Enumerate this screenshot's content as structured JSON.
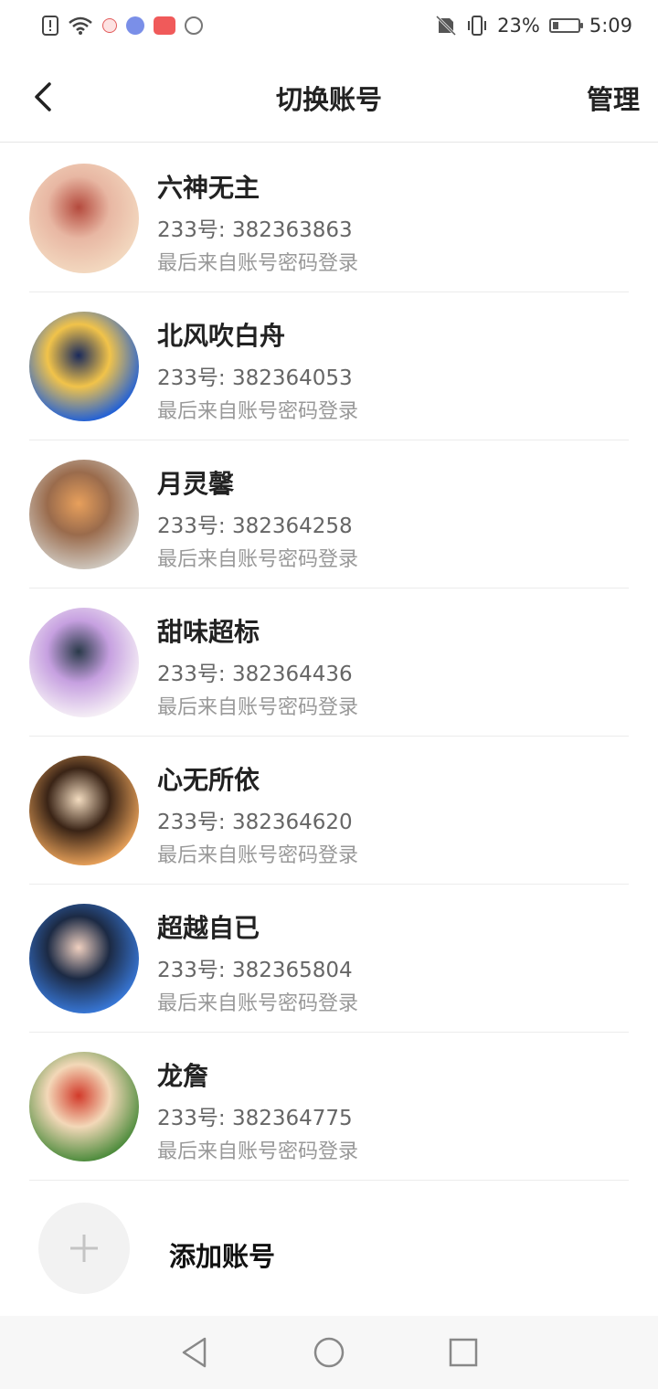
{
  "status_bar": {
    "battery_percent_text": "23%",
    "battery_level": 0.23,
    "time": "5:09",
    "icons": [
      "alert-icon",
      "wifi-icon",
      "app-icon",
      "music-app-icon",
      "store-app-icon",
      "game-app-icon",
      "no-sim-icon",
      "vibrate-icon",
      "battery-icon"
    ]
  },
  "header": {
    "title": "切换账号",
    "manage_label": "管理",
    "back_icon": "back-arrow-icon"
  },
  "accounts": [
    {
      "name": "六神无主",
      "id_text": "233号: 382363863",
      "login_text": "最后来自账号密码登录",
      "avatar_colors": [
        "#f3d9c0",
        "#e8b7a3",
        "#b44a3d"
      ]
    },
    {
      "name": "北风吹白舟",
      "id_text": "233号: 382364053",
      "login_text": "最后来自账号密码登录",
      "avatar_colors": [
        "#1f5fd8",
        "#f1c34a",
        "#1a2a5c"
      ]
    },
    {
      "name": "月灵馨",
      "id_text": "233号: 382364258",
      "login_text": "最后来自账号密码登录",
      "avatar_colors": [
        "#cfc8bf",
        "#9a6b4c",
        "#e8a05c"
      ]
    },
    {
      "name": "甜味超标",
      "id_text": "233号: 382364436",
      "login_text": "最后来自账号密码登录",
      "avatar_colors": [
        "#f6f0f6",
        "#c6a0e0",
        "#2a3a4a"
      ]
    },
    {
      "name": "心无所依",
      "id_text": "233号: 382364620",
      "login_text": "最后来自账号密码登录",
      "avatar_colors": [
        "#e9a25a",
        "#3a2416",
        "#f3dcc0"
      ]
    },
    {
      "name": "超越自已",
      "id_text": "233号: 382365804",
      "login_text": "最后来自账号密码登录",
      "avatar_colors": [
        "#3878d8",
        "#1c2a44",
        "#f0d0c0"
      ]
    },
    {
      "name": "龙詹",
      "id_text": "233号: 382364775",
      "login_text": "最后来自账号密码登录",
      "avatar_colors": [
        "#4a8a3a",
        "#f3d8b8",
        "#d23a2a"
      ]
    }
  ],
  "add_account": {
    "label": "添加账号",
    "icon": "plus-icon"
  },
  "system_nav": {
    "icons": [
      "back-triangle-icon",
      "home-circle-icon",
      "recents-square-icon"
    ]
  }
}
